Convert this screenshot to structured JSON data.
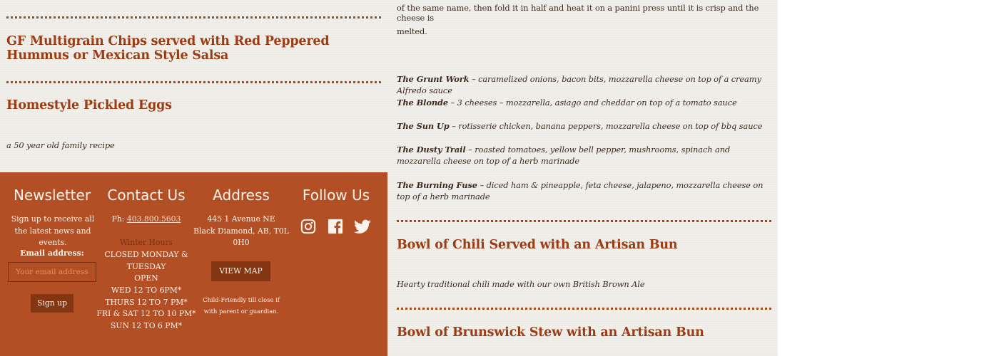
{
  "left_menu": {
    "item1": {
      "title": "GF Multigrain Chips served with Red Peppered Hummus or Mexican Style Salsa"
    },
    "item2": {
      "title": "Homestyle Pickled Eggs",
      "description": "a 50 year old family recipe"
    }
  },
  "right_menu": {
    "intro_line1": "of the same name, then fold it in half and heat it on a panini press until it is crisp and the cheese is",
    "intro_line2": "melted.",
    "sandwiches": [
      {
        "name": "The Grunt Work",
        "desc": " – caramelized onions, bacon bits, mozzarella cheese on top of a creamy Alfredo sauce"
      },
      {
        "name": "The Blonde",
        "desc": " – 3 cheeses – mozzarella, asiago and cheddar on top of a tomato sauce"
      },
      {
        "name": "The Sun Up",
        "desc": " – rotisserie chicken, banana peppers, mozzarella cheese on top of bbq sauce"
      },
      {
        "name": "The Dusty Trail",
        "desc": " – roasted tomatoes, yellow bell pepper, mushrooms, spinach and mozzarella cheese on top of a herb marinade"
      },
      {
        "name": "The Burning Fuse",
        "desc": " – diced ham & pineapple, feta cheese, jalapeno, mozzarella cheese on top of a herb marinade"
      }
    ],
    "chili": {
      "title": "Bowl of Chili Served with an Artisan Bun",
      "description": "Hearty traditional chili made with our own British Brown Ale"
    },
    "stew": {
      "title": "Bowl of Brunswick Stew with an Artisan Bun"
    }
  },
  "footer": {
    "newsletter": {
      "heading": "Newsletter",
      "text": "Sign up to receive all the latest news and events.",
      "email_label": "Email address:",
      "email_placeholder": "Your email address",
      "button": "Sign up"
    },
    "contact": {
      "heading": "Contact Us",
      "phone_label": "Ph: ",
      "phone": "403.800.5603",
      "hours_title": "Winter Hours",
      "hours": [
        "CLOSED MONDAY &",
        "TUESDAY",
        "OPEN",
        "WED 12 TO 6PM*",
        "THURS 12 TO 7 PM*",
        "FRI & SAT 12 TO 10 PM*",
        "SUN 12 TO 6 PM*"
      ]
    },
    "address": {
      "heading": "Address",
      "line1": "445 1 Avenue NE",
      "line2": "Black Diamond, AB, T0L",
      "line3": "0H0",
      "button": "VIEW MAP",
      "note_line1": "Child-Friendly till close if",
      "note_line2": "with parent or guardian."
    },
    "follow": {
      "heading": "Follow Us",
      "icons": [
        "instagram-icon",
        "facebook-icon",
        "twitter-icon"
      ]
    }
  },
  "colors": {
    "accent": "#9b3c14",
    "footer_bg": "#b34f25",
    "button_bg": "#843612",
    "paper": "#f1efea"
  }
}
